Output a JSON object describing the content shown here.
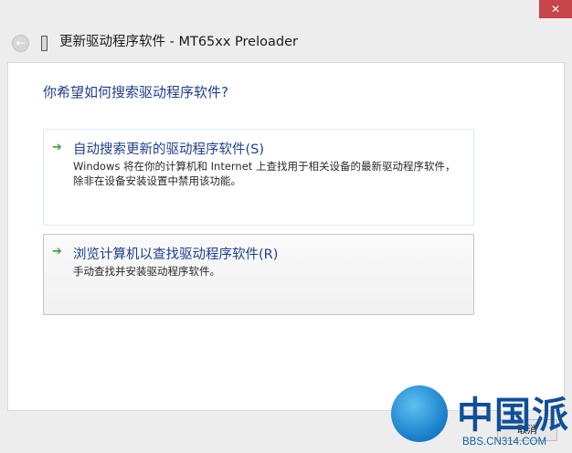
{
  "window": {
    "title": "更新驱动程序软件 - MT65xx Preloader",
    "close_glyph": "✕"
  },
  "icons": {
    "back": "back-arrow-icon",
    "device": "usb-device-icon",
    "option": "green-arrow-icon"
  },
  "colors": {
    "heading": "#1e3f8f",
    "arrow": "#3ca437",
    "close": "#c8454a"
  },
  "dialog": {
    "heading": "你希望如何搜索驱动程序软件?",
    "options": [
      {
        "title": "自动搜索更新的驱动程序软件(S)",
        "description": "Windows 将在你的计算机和 Internet 上查找用于相关设备的最新驱动程序软件，除非在设备安装设置中禁用该功能。"
      },
      {
        "title": "浏览计算机以查找驱动程序软件(R)",
        "description": "手动查找并安装驱动程序软件。"
      }
    ],
    "cancel_label": "取消"
  },
  "watermark": {
    "brand": "中国派",
    "domain": "BBS.CN314.COM"
  }
}
